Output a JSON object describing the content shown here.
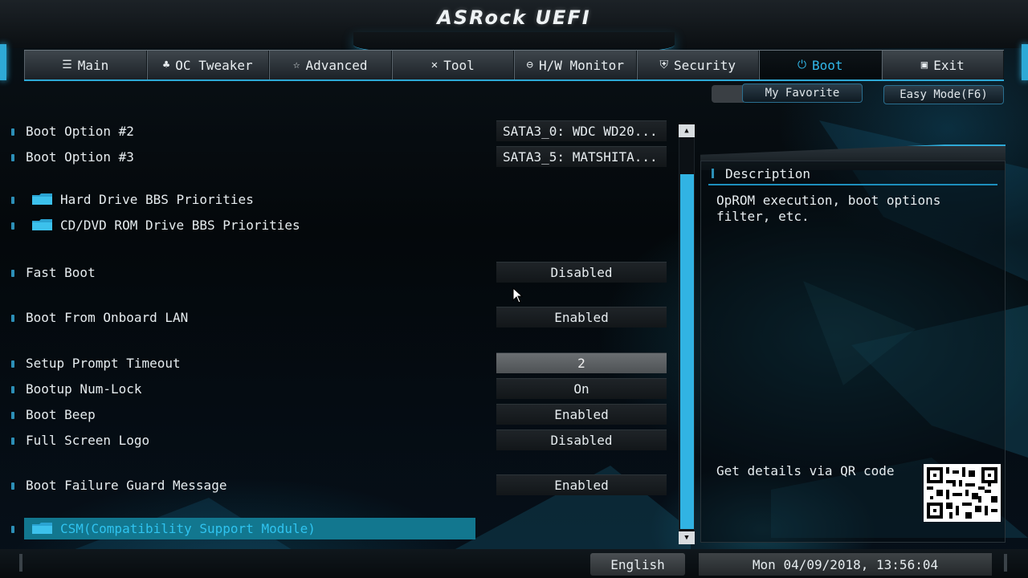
{
  "header": {
    "logo": "ASRock UEFI"
  },
  "tabs": [
    {
      "label": "Main",
      "icon": "list-icon",
      "glyph": "☰",
      "active": false
    },
    {
      "label": "OC Tweaker",
      "icon": "rocket-icon",
      "glyph": "♣",
      "active": false
    },
    {
      "label": "Advanced",
      "icon": "star-icon",
      "glyph": "☆",
      "active": false
    },
    {
      "label": "Tool",
      "icon": "tools-icon",
      "glyph": "✕",
      "active": false
    },
    {
      "label": "H/W Monitor",
      "icon": "monitor-icon",
      "glyph": "⊖",
      "active": false
    },
    {
      "label": "Security",
      "icon": "shield-icon",
      "glyph": "⛨",
      "active": false
    },
    {
      "label": "Boot",
      "icon": "power-icon",
      "glyph": "⏻",
      "active": true
    },
    {
      "label": "Exit",
      "icon": "exit-icon",
      "glyph": "▣",
      "active": false
    }
  ],
  "subbuttons": {
    "favorite": "My Favorite",
    "easy_mode": "Easy Mode(F6)"
  },
  "settings": {
    "boot_option_2": {
      "label": "Boot Option #2",
      "value": "SATA3_0: WDC WD20..."
    },
    "boot_option_3": {
      "label": "Boot Option #3",
      "value": "SATA3_5: MATSHITA..."
    },
    "hdd_bbs": {
      "label": "Hard Drive BBS Priorities"
    },
    "cddvd_bbs": {
      "label": "CD/DVD ROM Drive BBS Priorities"
    },
    "fast_boot": {
      "label": "Fast Boot",
      "value": "Disabled"
    },
    "boot_lan": {
      "label": "Boot From Onboard LAN",
      "value": "Enabled"
    },
    "setup_timeout": {
      "label": "Setup Prompt Timeout",
      "value": "2"
    },
    "numlock": {
      "label": "Bootup Num-Lock",
      "value": "On"
    },
    "boot_beep": {
      "label": "Boot Beep",
      "value": "Enabled"
    },
    "full_logo": {
      "label": "Full Screen Logo",
      "value": "Disabled"
    },
    "failure_guard": {
      "label": "Boot Failure Guard Message",
      "value": "Enabled"
    },
    "csm": {
      "label": "CSM(Compatibility Support Module)"
    }
  },
  "description": {
    "title": "Description",
    "text": "OpROM execution, boot options filter, etc.",
    "qr_label": "Get details via QR code"
  },
  "status": {
    "language": "English",
    "datetime": "Mon 04/09/2018, 13:56:04"
  },
  "colors": {
    "accent": "#2ea9d6",
    "selection": "#12778f",
    "scrollbar": "#31b3e3"
  }
}
